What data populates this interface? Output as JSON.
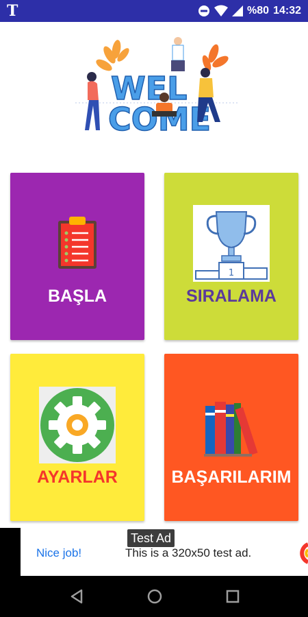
{
  "status_bar": {
    "app_letter": "T",
    "battery": "%80",
    "time": "14:32",
    "icons": [
      "dnd-icon",
      "wifi-icon",
      "signal-icon",
      "battery-icon"
    ]
  },
  "header": {
    "welcome_image": "welcome-illustration",
    "line1": "WEL",
    "line2": "COME"
  },
  "menu": {
    "start": {
      "label": "BAŞLA",
      "icon": "clipboard-checklist-icon",
      "bg": "#9c27b0",
      "color": "#ffffff"
    },
    "ranking": {
      "label": "SIRALAMA",
      "icon": "trophy-icon",
      "bg": "#cddc39",
      "color": "#5b3a9a"
    },
    "settings": {
      "label": "AYARLAR",
      "icon": "gear-icon",
      "bg": "#ffeb3b",
      "color": "#f4362b"
    },
    "achievements": {
      "label": "BAŞARILARIM",
      "icon": "books-icon",
      "bg": "#ff5722",
      "color": "#ffffff"
    }
  },
  "ad": {
    "badge": "Test Ad",
    "nice": "Nice job!",
    "text": "This is a 320x50 test ad."
  },
  "nav": {
    "icons": [
      "back-icon",
      "home-icon",
      "recents-icon"
    ]
  }
}
